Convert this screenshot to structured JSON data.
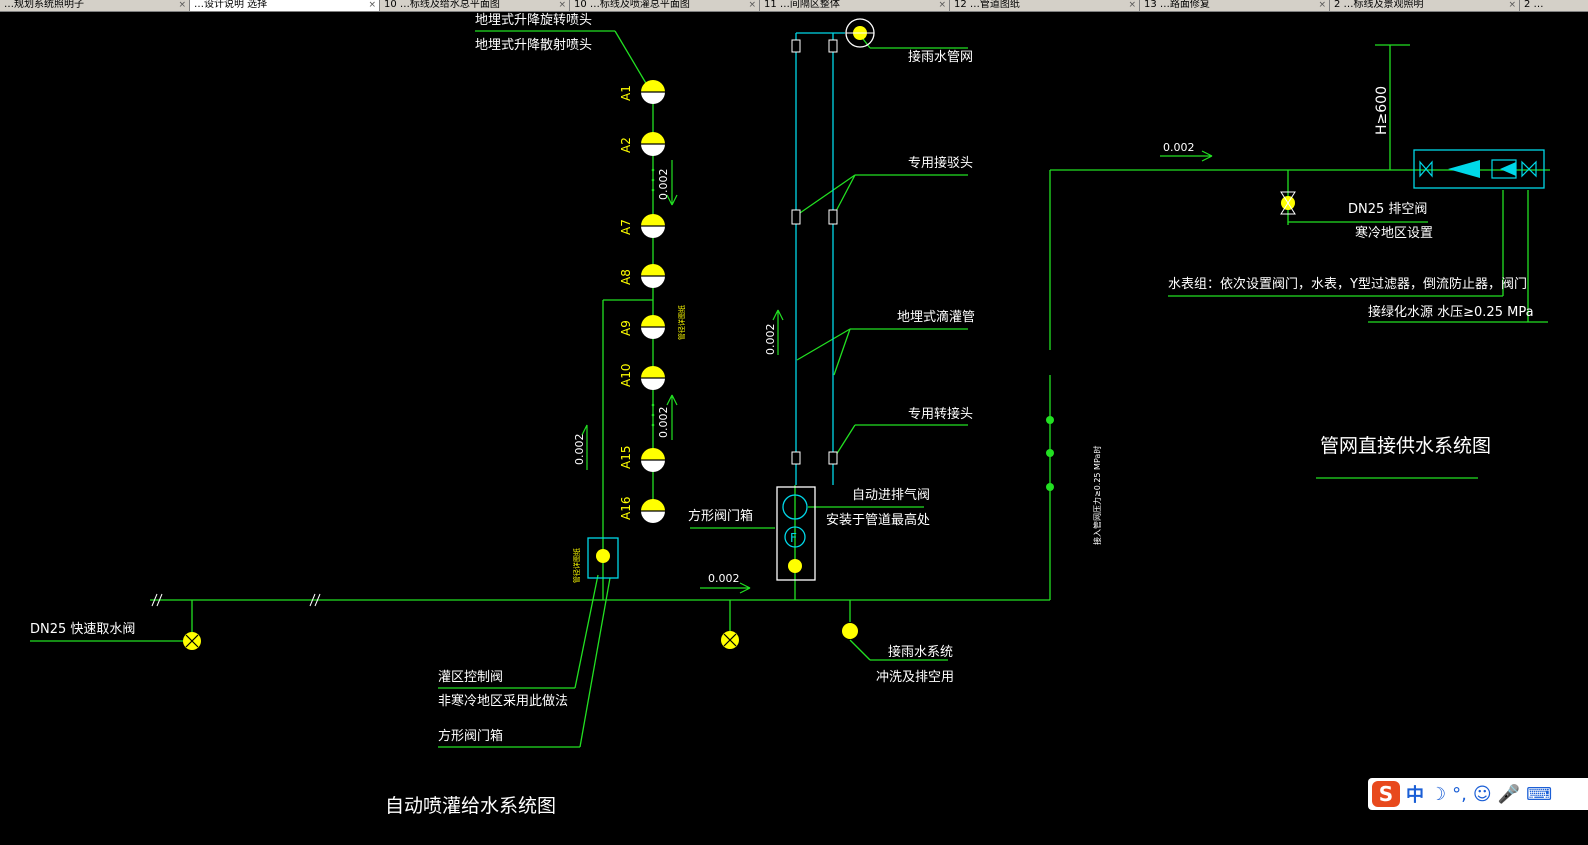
{
  "tabs": [
    {
      "label": "…规划系统照明子",
      "active": false
    },
    {
      "label": "…设计说明 选择",
      "active": true
    },
    {
      "label": "10 …标线及给水总平面图",
      "active": false
    },
    {
      "label": "10 …标线及喷灌总平面图",
      "active": false
    },
    {
      "label": "11 …间隔区整体",
      "active": false
    },
    {
      "label": "12 …管道图纸",
      "active": false
    },
    {
      "label": "13 …路面修复",
      "active": false
    },
    {
      "label": "2 …标线及景观照明",
      "active": false
    },
    {
      "label": "2 …",
      "active": false
    }
  ],
  "left_diagram": {
    "title": "自动喷灌给水系统图",
    "nozzle_label_1": "地埋式升降旋转喷头",
    "nozzle_label_2": "地埋式升降散射喷头",
    "nozzles": [
      "A1",
      "A2",
      "A7",
      "A8",
      "A9",
      "A10",
      "A15",
      "A16"
    ],
    "slope_1": "0.002",
    "slope_2": "0.002",
    "slope_3": "0.002",
    "slope_4": "0.002",
    "slope_5": "0.002",
    "rain_pipe_label": "接雨水管网",
    "special_joint_1": "专用接驳头",
    "drip_pipe_label": "地埋式滴灌管",
    "special_joint_2": "专用转接头",
    "auto_valve_label": "自动进排气阀",
    "auto_valve_note": "安装于管道最高处",
    "valve_box_label_1": "方形阀门箱",
    "quick_valve_label": "DN25 快速取水阀",
    "zone_valve_label": "灌区控制阀",
    "zone_valve_note": "非寒冷地区采用此做法",
    "valve_box_label_2": "方形阀门箱",
    "rain_system_label": "接雨水系统",
    "rain_system_note": "冲洗及排空用",
    "pressure_note": "接入管网压力≥0.25 MPa时",
    "detail_note_1": "管径详图纸",
    "detail_note_2": "管径详图纸"
  },
  "right_diagram": {
    "title": "管网直接供水系统图",
    "height_label": "H≥600",
    "slope": "0.002",
    "drain_valve_label": "DN25 排空阀",
    "drain_valve_note": "寒冷地区设置",
    "meter_group_label": "水表组：依次设置阀门，水表，Y型过滤器，倒流防止器，阀门",
    "water_source_label": "接绿化水源  水压≥0.25 MPa"
  },
  "ime": {
    "logo": "S",
    "lang": "中",
    "moon": "☽",
    "punct": "°,",
    "emoji": "☺",
    "mic": "🎤",
    "keyboard": "⌨"
  },
  "colors": {
    "green": "#22e022",
    "cyan": "#00d8e8",
    "yellow": "#ffff00",
    "white": "#ffffff"
  }
}
